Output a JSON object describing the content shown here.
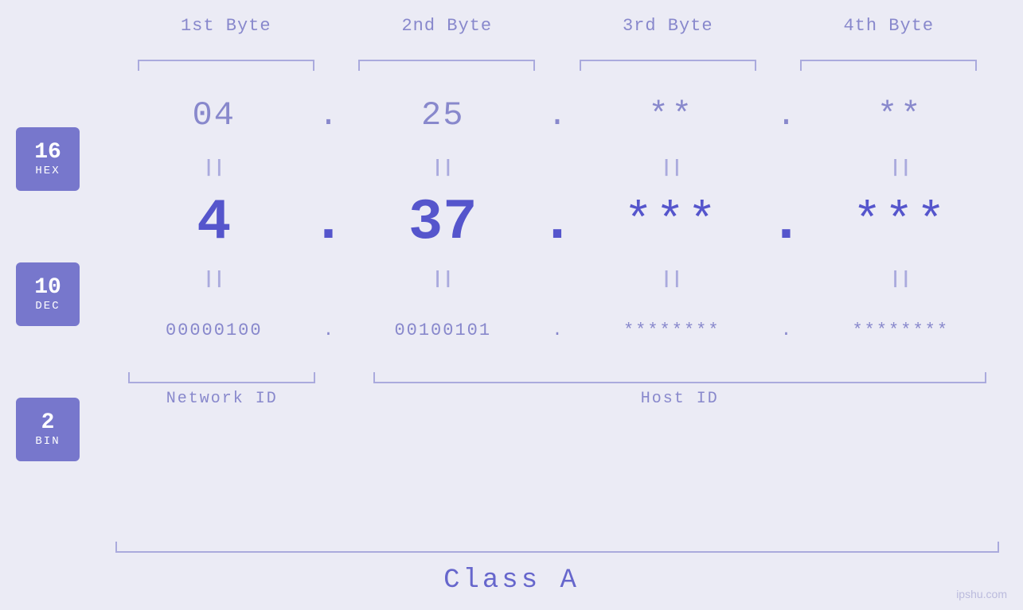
{
  "background": "#ebebf5",
  "header": {
    "byte1": "1st Byte",
    "byte2": "2nd Byte",
    "byte3": "3rd Byte",
    "byte4": "4th Byte"
  },
  "bases": [
    {
      "num": "16",
      "label": "HEX"
    },
    {
      "num": "10",
      "label": "DEC"
    },
    {
      "num": "2",
      "label": "BIN"
    }
  ],
  "rows": {
    "hex": {
      "b1": "04",
      "b2": "25",
      "b3": "**",
      "b4": "**",
      "dot": "."
    },
    "dec": {
      "b1": "4",
      "b2": "37",
      "b3": "***",
      "b4": "***",
      "dot": "."
    },
    "bin": {
      "b1": "00000100",
      "b2": "00100101",
      "b3": "********",
      "b4": "********",
      "dot": "."
    }
  },
  "labels": {
    "network_id": "Network ID",
    "host_id": "Host ID",
    "class": "Class A"
  },
  "watermark": "ipshu.com",
  "equals": "||"
}
